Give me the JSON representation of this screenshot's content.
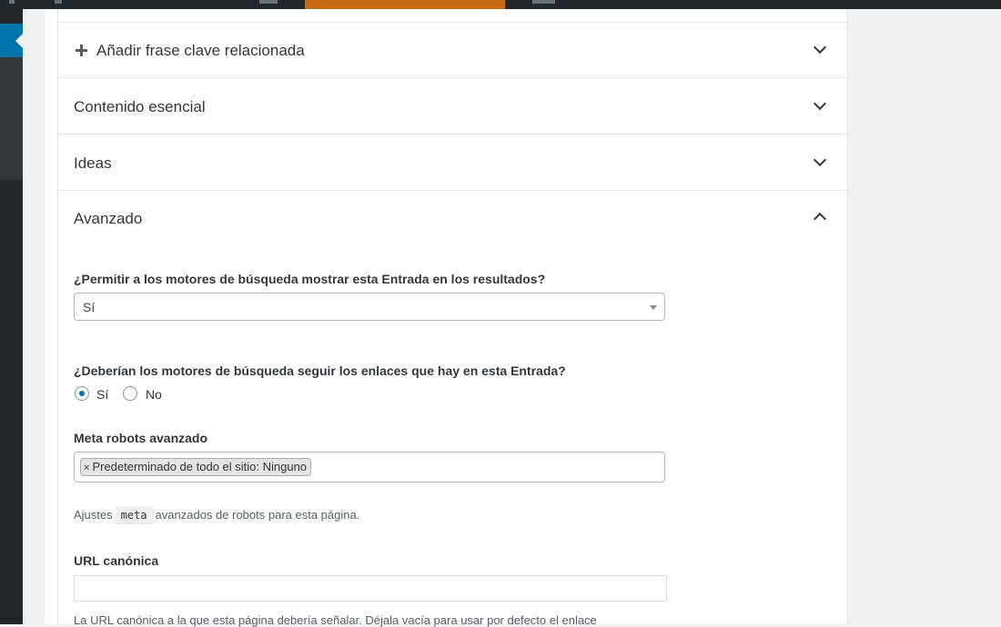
{
  "panels": {
    "related_keyphrase": "Añadir frase clave relacionada",
    "cornerstone": "Contenido esencial",
    "insights": "Ideas",
    "advanced": "Avanzado"
  },
  "advanced": {
    "index_question": "¿Permitir a los motores de búsqueda mostrar esta Entrada en los resultados?",
    "index_value": "Sí",
    "follow_question": "¿Deberían los motores de búsqueda seguir los enlaces que hay en esta Entrada?",
    "follow_options": [
      "Sí",
      "No"
    ],
    "follow_selected": "Sí",
    "meta_robots_label": "Meta robots avanzado",
    "meta_robots_chip": "Predeterminado de todo el sitio: Ninguno",
    "meta_robots_chip_remove": "×",
    "meta_help_before": "Ajustes",
    "meta_help_code": "meta",
    "meta_help_after": "avanzados de robots para esta página.",
    "canonical_label": "URL canónica",
    "canonical_value": "",
    "canonical_help": "La URL canónica a la que esta página debería señalar. Déjala vacía para usar por defecto el enlace"
  },
  "colors": {
    "admin_bar": "#23282d",
    "admin_accent": "#c46a12",
    "sidebar_active": "#0073aa",
    "radio_checked": "#0073aa"
  }
}
